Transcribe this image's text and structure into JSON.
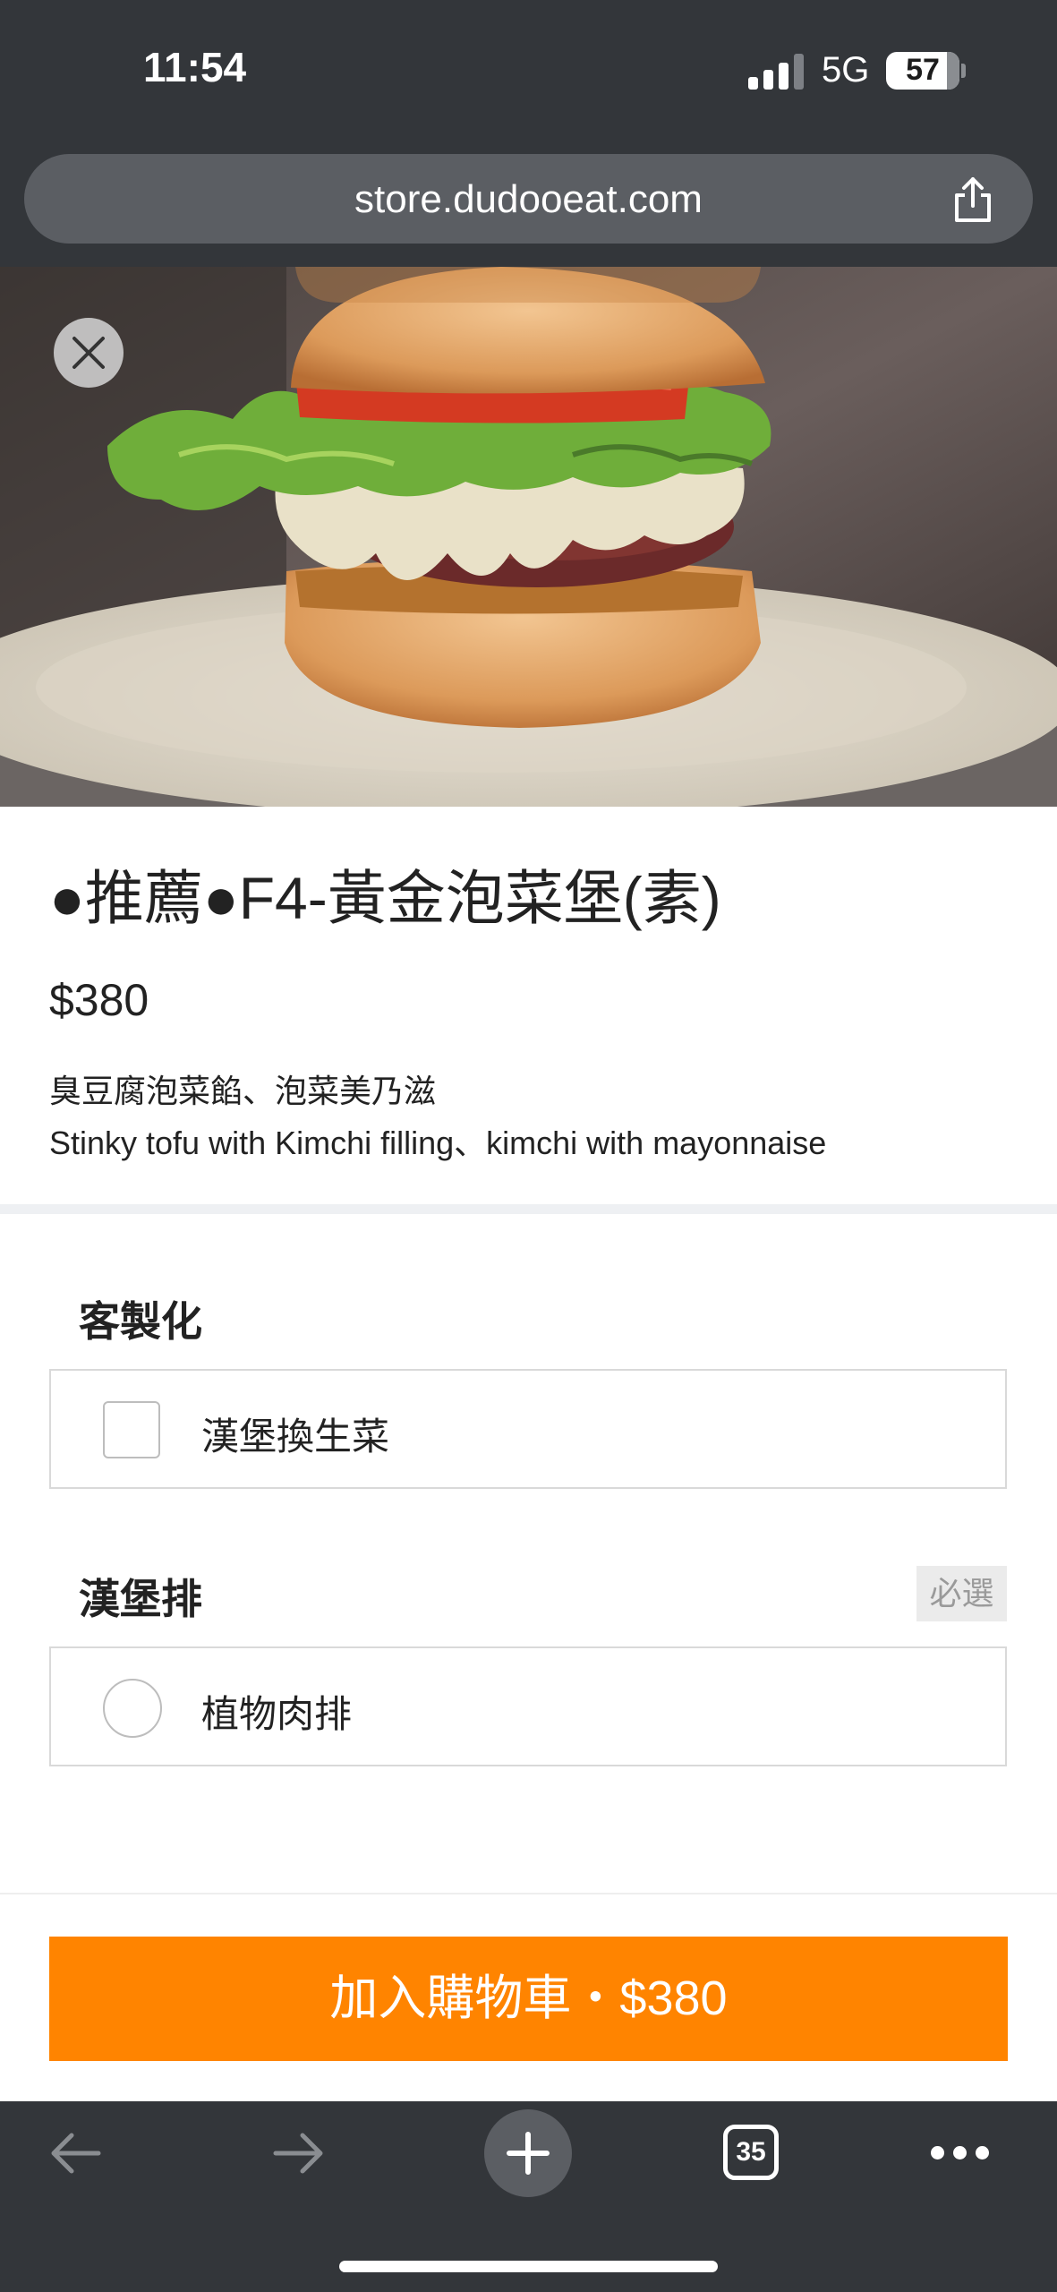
{
  "status_bar": {
    "time": "11:54",
    "network": "5G",
    "battery": "57"
  },
  "browser": {
    "url": "store.dudooeat.com",
    "tab_count": "35"
  },
  "product": {
    "title": "●推薦●F4-黃金泡菜堡(素)",
    "price": "$380",
    "description_zh": "臭豆腐泡菜餡、泡菜美乃滋",
    "description_en": "Stinky tofu with Kimchi filling、kimchi with mayonnaise"
  },
  "sections": [
    {
      "title": "客製化",
      "options": [
        {
          "label": "漢堡換生菜",
          "type": "checkbox",
          "checked": false
        }
      ]
    },
    {
      "title": "漢堡排",
      "badge": "必選",
      "options": [
        {
          "label": "植物肉排",
          "type": "radio",
          "checked": false
        }
      ]
    }
  ],
  "cart_button": {
    "label": "加入購物車・$380"
  },
  "colors": {
    "accent": "#ff8400",
    "chrome": "#33363a",
    "url_pill": "#5b5e63"
  },
  "icons": [
    "share-icon",
    "close-icon",
    "back-arrow-icon",
    "forward-arrow-icon",
    "plus-icon",
    "tabs-icon",
    "more-icon"
  ]
}
